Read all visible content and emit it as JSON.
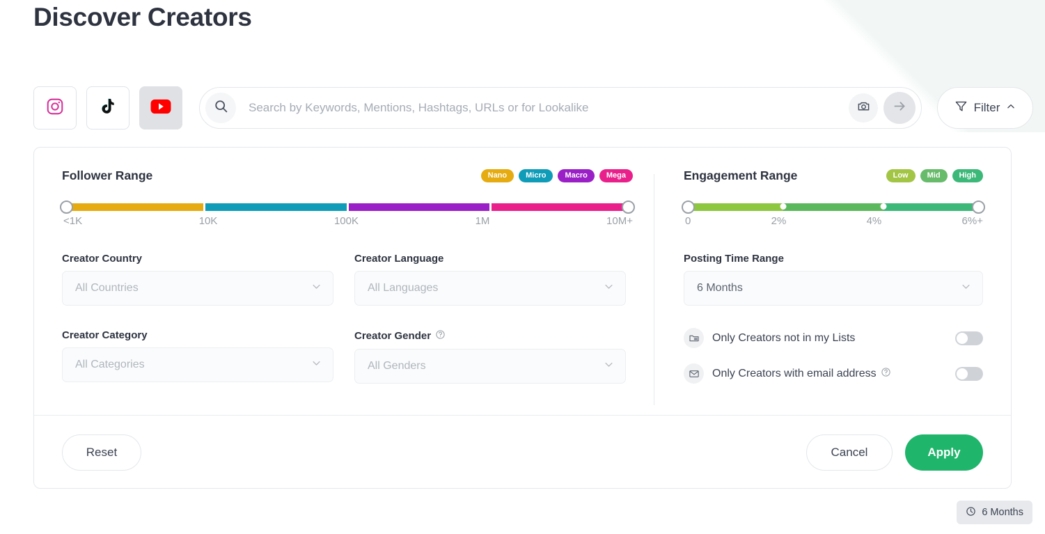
{
  "page": {
    "title": "Discover Creators"
  },
  "toolbar": {
    "platforms": [
      {
        "name": "instagram",
        "icon": "instagram-icon",
        "selected": false
      },
      {
        "name": "tiktok",
        "icon": "tiktok-icon",
        "selected": false
      },
      {
        "name": "youtube",
        "icon": "youtube-icon",
        "selected": true
      }
    ],
    "search": {
      "icon": "search-icon",
      "placeholder": "Search by Keywords, Mentions, Hashtags, URLs or for Lookalike",
      "value": "",
      "camera_icon": "camera-icon",
      "submit_icon": "arrow-right-icon"
    },
    "filter": {
      "icon": "funnel-icon",
      "label": "Filter",
      "chevron": "chevron-up-icon"
    }
  },
  "filters": {
    "follower_range": {
      "title": "Follower Range",
      "badges": [
        {
          "label": "Nano",
          "color": "#e5ab10"
        },
        {
          "label": "Micro",
          "color": "#0e9cb8"
        },
        {
          "label": "Macro",
          "color": "#9a1fc6"
        },
        {
          "label": "Mega",
          "color": "#e9208b"
        }
      ],
      "segments": [
        {
          "color": "#e5ab10"
        },
        {
          "color": "#0e9cb8"
        },
        {
          "color": "#9a1fc6"
        },
        {
          "color": "#e9208b"
        }
      ],
      "ticks": [
        "<1K",
        "10K",
        "100K",
        "1M",
        "10M+"
      ],
      "handle_left_value": "<1K",
      "handle_right_value": "10M+"
    },
    "engagement_range": {
      "title": "Engagement Range",
      "badges": [
        {
          "label": "Low",
          "color": "#a3c546"
        },
        {
          "label": "Mid",
          "color": "#67bb6a"
        },
        {
          "label": "High",
          "color": "#3cb878"
        }
      ],
      "segments": [
        {
          "color": "#8dc63f"
        },
        {
          "color": "#5cb85c"
        },
        {
          "color": "#3cb878"
        }
      ],
      "ticks": [
        "0",
        "2%",
        "4%",
        "6%+"
      ],
      "handle_left_value": "0",
      "handle_right_value": "6%+"
    },
    "creator_country": {
      "label": "Creator Country",
      "value": "",
      "placeholder": "All Countries",
      "chevron": "chevron-down-icon"
    },
    "creator_language": {
      "label": "Creator Language",
      "value": "",
      "placeholder": "All Languages",
      "chevron": "chevron-down-icon"
    },
    "creator_category": {
      "label": "Creator Category",
      "value": "",
      "placeholder": "All Categories",
      "chevron": "chevron-down-icon"
    },
    "creator_gender": {
      "label": "Creator Gender",
      "help_icon": "help-circle-icon",
      "value": "",
      "placeholder": "All Genders",
      "chevron": "chevron-down-icon"
    },
    "posting_time_range": {
      "label": "Posting Time Range",
      "value": "6 Months",
      "chevron": "chevron-down-icon"
    },
    "toggles": [
      {
        "icon": "list-folder-icon",
        "label": "Only Creators not in my Lists",
        "enabled": false,
        "has_help": false
      },
      {
        "icon": "envelope-icon",
        "label": "Only Creators with email address",
        "enabled": false,
        "has_help": true,
        "help_icon": "help-circle-icon"
      }
    ]
  },
  "footer": {
    "reset_label": "Reset",
    "cancel_label": "Cancel",
    "apply_label": "Apply",
    "apply_color": "#1fb56b"
  },
  "time_chip": {
    "icon": "clock-icon",
    "label": "6 Months"
  }
}
